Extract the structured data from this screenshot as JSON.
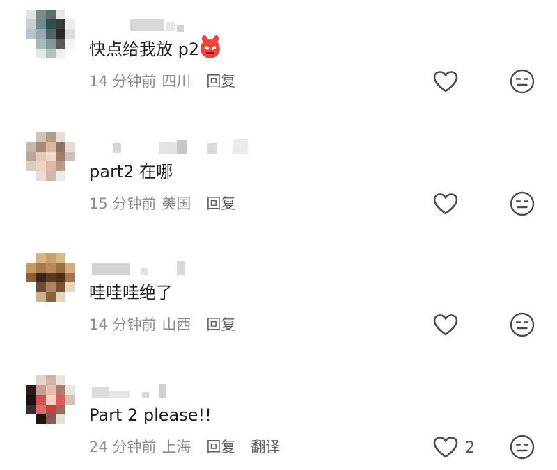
{
  "comments": [
    {
      "text": "快点给我放 p2",
      "has_emoji": true,
      "emoji": "devil-face-icon",
      "time": "14 分钟前",
      "region": "四川",
      "reply_label": "回复",
      "like_icon": "heart-outline-icon",
      "dislike_icon": "meh-face-icon"
    },
    {
      "text": "part2 在哪",
      "time": "15 分钟前",
      "region": "美国",
      "reply_label": "回复",
      "like_icon": "heart-outline-icon",
      "dislike_icon": "meh-face-icon"
    },
    {
      "text": "哇哇哇绝了",
      "time": "14 分钟前",
      "region": "山西",
      "reply_label": "回复",
      "like_icon": "heart-outline-icon",
      "dislike_icon": "meh-face-icon"
    },
    {
      "text": "Part 2 please!!",
      "time": "24 分钟前",
      "region": "上海",
      "reply_label": "回复",
      "translate_label": "翻译",
      "like_count": "2",
      "like_icon": "heart-outline-icon",
      "dislike_icon": "meh-face-icon"
    }
  ],
  "colors": {
    "text_primary": "#1e1e1e",
    "text_meta": "#8e8e8e",
    "action_text": "#5f5f5f",
    "icon_stroke": "#4a4a4a",
    "emoji_red": "#f0443a"
  }
}
